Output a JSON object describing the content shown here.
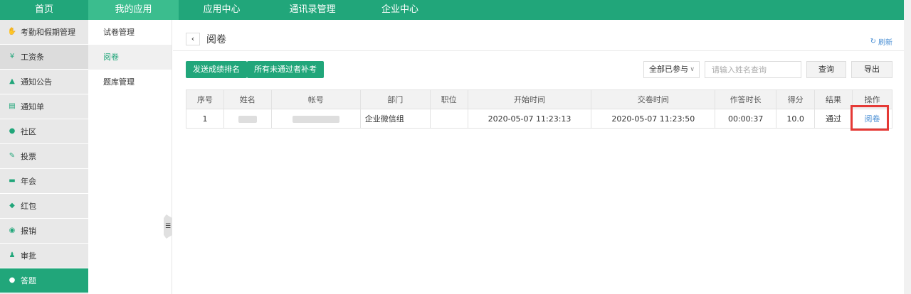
{
  "topnav": {
    "tabs": [
      "首页",
      "我的应用",
      "应用中心",
      "通讯录管理",
      "企业中心"
    ],
    "active": 1
  },
  "sidebar": {
    "items": [
      {
        "label": "考勤和假期管理",
        "icon": "hand-icon"
      },
      {
        "label": "工资条",
        "icon": "money-icon"
      },
      {
        "label": "通知公告",
        "icon": "bell-icon"
      },
      {
        "label": "通知单",
        "icon": "list-icon"
      },
      {
        "label": "社区",
        "icon": "chat-icon"
      },
      {
        "label": "投票",
        "icon": "vote-icon"
      },
      {
        "label": "年会",
        "icon": "ticket-icon"
      },
      {
        "label": "红包",
        "icon": "redpacket-icon"
      },
      {
        "label": "报销",
        "icon": "yen-icon"
      },
      {
        "label": "审批",
        "icon": "stamp-icon"
      },
      {
        "label": "答题",
        "icon": "quiz-icon"
      }
    ]
  },
  "submenu": {
    "items": [
      "试卷管理",
      "阅卷",
      "题库管理"
    ]
  },
  "page": {
    "title": "阅卷",
    "refresh": "刷新"
  },
  "toolbar": {
    "send_rank": "发送成绩排名",
    "makeup": "所有未通过者补考",
    "filter_value": "全部已参与",
    "search_placeholder": "请输入姓名查询",
    "query": "查询",
    "export": "导出"
  },
  "table": {
    "headers": [
      "序号",
      "姓名",
      "帐号",
      "部门",
      "职位",
      "开始时间",
      "交卷时间",
      "作答时长",
      "得分",
      "结果",
      "操作"
    ],
    "rows": [
      {
        "index": "1",
        "department": "企业微信组",
        "position": "",
        "start": "2020-05-07 11:23:13",
        "submit": "2020-05-07 11:23:50",
        "duration": "00:00:37",
        "score": "10.0",
        "result": "通过",
        "action": "阅卷"
      }
    ]
  },
  "colors": {
    "brand": "#21a67a",
    "link": "#4a8fd4",
    "highlight": "#e53935"
  }
}
